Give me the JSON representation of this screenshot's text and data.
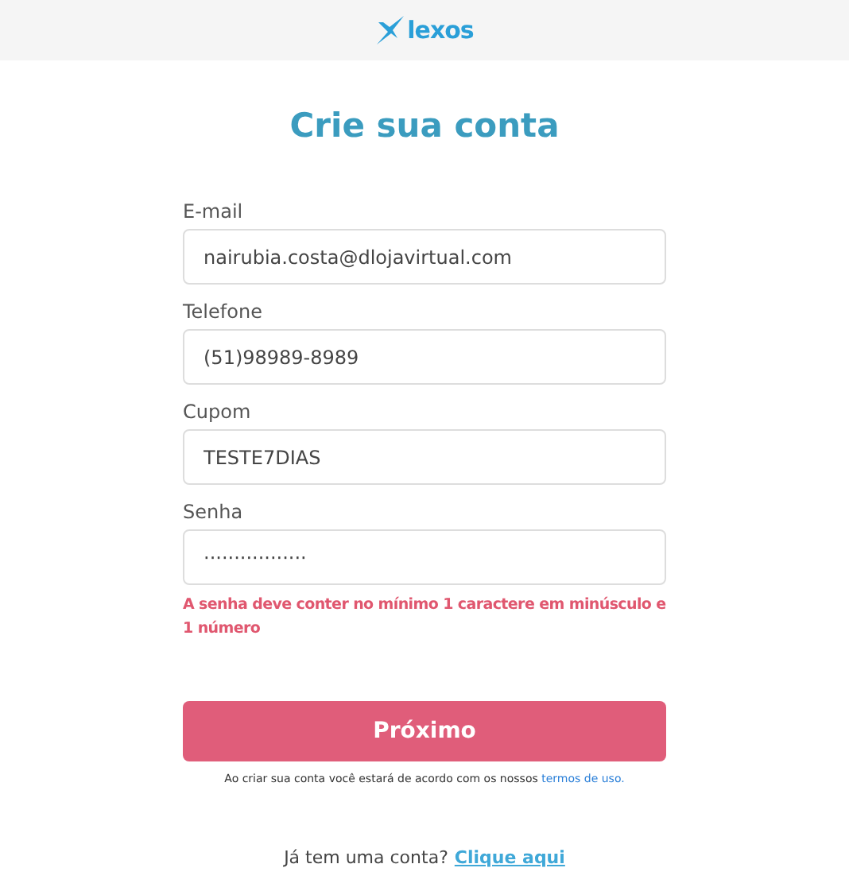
{
  "header": {
    "logo_text": "lexos"
  },
  "title": "Crie sua conta",
  "fields": [
    {
      "label": "E-mail",
      "value": "nairubia.costa@dlojavirtual.com"
    },
    {
      "label": "Telefone",
      "value": "(51)98989-8989"
    },
    {
      "label": "Cupom",
      "value": "TESTE7DIAS"
    },
    {
      "label": "Senha",
      "value": "·················",
      "error": "A senha deve conter no mínimo 1 caractere em minúsculo e 1 número"
    }
  ],
  "submit": "Próximo",
  "terms": {
    "text": "Ao criar sua conta você estará de acordo com os nossos ",
    "link": "termos de uso."
  },
  "login": {
    "text": "Já tem uma conta?",
    "link": "Clique aqui"
  }
}
